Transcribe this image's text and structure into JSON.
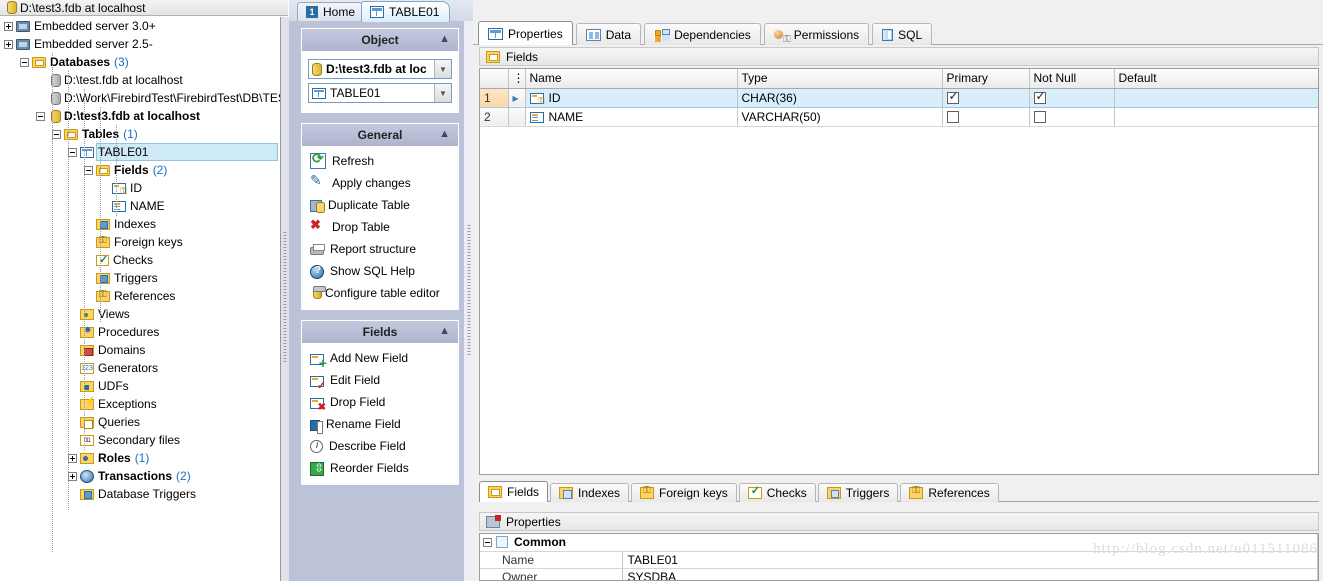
{
  "window": {
    "title": "D:\\test3.fdb at localhost"
  },
  "doc_tabs": [
    {
      "label": "Home",
      "icon": "home-icon",
      "badge": "1",
      "active": false
    },
    {
      "label": "TABLE01",
      "icon": "table-icon",
      "active": true
    }
  ],
  "tree": [
    {
      "depth": 0,
      "label": "Embedded server 3.0+",
      "icon": "server-icon",
      "expander": "plus",
      "bold": false
    },
    {
      "depth": 0,
      "label": "Embedded server 2.5-",
      "icon": "server-icon",
      "expander": "plus",
      "bold": false
    },
    {
      "depth": 1,
      "label": "Databases",
      "count": "(3)",
      "icon": "folder-icon",
      "expander": "minus",
      "bold": true
    },
    {
      "depth": 2,
      "label": "D:\\test.fdb at localhost",
      "icon": "database-offline-icon",
      "expander": "none",
      "bold": false
    },
    {
      "depth": 2,
      "label": "D:\\Work\\FirebirdTest\\FirebirdTest\\DB\\TEST.F",
      "icon": "database-offline-icon",
      "expander": "none",
      "bold": false
    },
    {
      "depth": 2,
      "label": "D:\\test3.fdb at localhost",
      "icon": "database-icon",
      "expander": "minus",
      "bold": true
    },
    {
      "depth": 3,
      "label": "Tables",
      "count": "(1)",
      "icon": "tables-folder-icon",
      "expander": "minus",
      "bold": true
    },
    {
      "depth": 4,
      "label": "TABLE01",
      "icon": "table-icon",
      "expander": "minus",
      "bold": false,
      "selected": true
    },
    {
      "depth": 5,
      "label": "Fields",
      "count": "(2)",
      "icon": "fields-folder-icon",
      "expander": "minus",
      "bold": true
    },
    {
      "depth": 6,
      "label": "ID",
      "icon": "field-primary-key-icon",
      "expander": "none",
      "bold": false
    },
    {
      "depth": 6,
      "label": "NAME",
      "icon": "field-icon",
      "expander": "none",
      "bold": false
    },
    {
      "depth": 5,
      "label": "Indexes",
      "icon": "indexes-folder-icon",
      "expander": "none",
      "bold": false
    },
    {
      "depth": 5,
      "label": "Foreign keys",
      "icon": "foreign-key-folder-icon",
      "expander": "none",
      "bold": false
    },
    {
      "depth": 5,
      "label": "Checks",
      "icon": "checks-folder-icon",
      "expander": "none",
      "bold": false
    },
    {
      "depth": 5,
      "label": "Triggers",
      "icon": "triggers-folder-icon",
      "expander": "none",
      "bold": false
    },
    {
      "depth": 5,
      "label": "References",
      "icon": "references-folder-icon",
      "expander": "none",
      "bold": false
    },
    {
      "depth": 4,
      "label": "Views",
      "icon": "views-folder-icon",
      "expander": "none",
      "bold": false
    },
    {
      "depth": 4,
      "label": "Procedures",
      "icon": "procedures-folder-icon",
      "expander": "none",
      "bold": false
    },
    {
      "depth": 4,
      "label": "Domains",
      "icon": "domains-folder-icon",
      "expander": "none",
      "bold": false
    },
    {
      "depth": 4,
      "label": "Generators",
      "icon": "generators-folder-icon",
      "expander": "none",
      "bold": false
    },
    {
      "depth": 4,
      "label": "UDFs",
      "icon": "udfs-folder-icon",
      "expander": "none",
      "bold": false
    },
    {
      "depth": 4,
      "label": "Exceptions",
      "icon": "exceptions-folder-icon",
      "expander": "none",
      "bold": false
    },
    {
      "depth": 4,
      "label": "Queries",
      "icon": "queries-folder-icon",
      "expander": "none",
      "bold": false
    },
    {
      "depth": 4,
      "label": "Secondary files",
      "icon": "secondary-files-icon",
      "expander": "none",
      "bold": false
    },
    {
      "depth": 4,
      "label": "Roles",
      "count": "(1)",
      "icon": "roles-icon",
      "expander": "plus",
      "bold": true
    },
    {
      "depth": 4,
      "label": "Transactions",
      "count": "(2)",
      "icon": "transactions-icon",
      "expander": "plus",
      "bold": true
    },
    {
      "depth": 4,
      "label": "Database Triggers",
      "icon": "triggers-folder-icon",
      "expander": "none",
      "bold": false
    }
  ],
  "object_panel": {
    "title": "Object",
    "database": "D:\\test3.fdb at loc",
    "table": "TABLE01"
  },
  "general_panel": {
    "title": "General",
    "actions": [
      {
        "label": "Refresh",
        "icon": "refresh-icon"
      },
      {
        "label": "Apply changes",
        "icon": "apply-changes-icon"
      },
      {
        "label": "Duplicate Table",
        "icon": "duplicate-table-icon"
      },
      {
        "label": "Drop Table",
        "icon": "drop-table-icon"
      },
      {
        "label": "Report structure",
        "icon": "report-structure-icon"
      },
      {
        "label": "Show SQL Help",
        "icon": "help-icon"
      },
      {
        "label": "Configure table editor",
        "icon": "configure-icon"
      }
    ]
  },
  "fields_panel": {
    "title": "Fields",
    "actions": [
      {
        "label": "Add New Field",
        "icon": "add-field-icon"
      },
      {
        "label": "Edit Field",
        "icon": "edit-field-icon"
      },
      {
        "label": "Drop Field",
        "icon": "drop-field-icon"
      },
      {
        "label": "Rename Field",
        "icon": "rename-field-icon"
      },
      {
        "label": "Describe Field",
        "icon": "describe-field-icon"
      },
      {
        "label": "Reorder Fields",
        "icon": "reorder-fields-icon"
      }
    ]
  },
  "view_tabs": [
    {
      "label": "Properties",
      "icon": "properties-icon",
      "active": true
    },
    {
      "label": "Data",
      "icon": "data-icon",
      "active": false
    },
    {
      "label": "Dependencies",
      "icon": "dependencies-icon",
      "active": false
    },
    {
      "label": "Permissions",
      "icon": "permissions-icon",
      "active": false
    },
    {
      "label": "SQL",
      "icon": "sql-icon",
      "active": false
    }
  ],
  "fields_band": {
    "label": "Fields",
    "icon": "fields-folder-icon"
  },
  "grid": {
    "columns": [
      "Name",
      "Type",
      "Primary",
      "Not Null",
      "Default"
    ],
    "rows": [
      {
        "num": "1",
        "marker": "▸",
        "name": "ID",
        "name_icon": "field-primary-key-icon",
        "type": "CHAR(36)",
        "primary": true,
        "not_null": true,
        "default": "",
        "selected": true
      },
      {
        "num": "2",
        "marker": "",
        "name": "NAME",
        "name_icon": "field-icon",
        "type": "VARCHAR(50)",
        "primary": false,
        "not_null": false,
        "default": "",
        "selected": false
      }
    ]
  },
  "bottom_tabs": [
    {
      "label": "Fields",
      "icon": "fields-folder-icon",
      "active": true
    },
    {
      "label": "Indexes",
      "icon": "indexes-folder-icon",
      "active": false
    },
    {
      "label": "Foreign keys",
      "icon": "foreign-key-folder-icon",
      "active": false
    },
    {
      "label": "Checks",
      "icon": "checks-folder-icon",
      "active": false
    },
    {
      "label": "Triggers",
      "icon": "triggers-folder-icon",
      "active": false
    },
    {
      "label": "References",
      "icon": "references-folder-icon",
      "active": false
    }
  ],
  "properties_band": {
    "label": "Properties",
    "icon": "properties-editor-icon"
  },
  "properties_grid": {
    "group": "Common",
    "rows": [
      {
        "name": "Name",
        "value": "TABLE01"
      },
      {
        "name": "Owner",
        "value": "SYSDBA"
      }
    ]
  },
  "watermark": "http://blog.csdn.net/u011511086",
  "colors": {
    "selection": "#cfeaf7",
    "grid_selection": "#d8eefb",
    "panel_bg": "#bcc2d8",
    "accent_link": "#1d6fc0"
  }
}
